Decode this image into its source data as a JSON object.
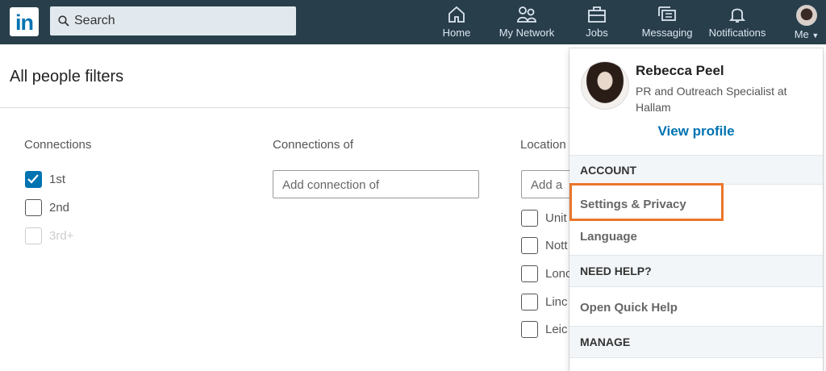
{
  "header": {
    "logo": "in",
    "search_placeholder": "Search",
    "nav": [
      {
        "label": "Home",
        "icon": "home-icon"
      },
      {
        "label": "My Network",
        "icon": "network-icon"
      },
      {
        "label": "Jobs",
        "icon": "briefcase-icon"
      },
      {
        "label": "Messaging",
        "icon": "messaging-icon"
      },
      {
        "label": "Notifications",
        "icon": "bell-icon"
      },
      {
        "label": "Me",
        "icon": "avatar"
      }
    ]
  },
  "page": {
    "title": "All people filters",
    "connections": {
      "label": "Connections",
      "options": [
        {
          "label": "1st",
          "checked": true
        },
        {
          "label": "2nd",
          "checked": false
        },
        {
          "label": "3rd+",
          "disabled": true
        }
      ]
    },
    "connections_of": {
      "label": "Connections of",
      "placeholder": "Add connection of"
    },
    "locations": {
      "label": "Location",
      "placeholder": "Add a",
      "options": [
        "Unit",
        "Nott",
        "Lonc",
        "Linc",
        "Leic"
      ]
    }
  },
  "menu": {
    "name": "Rebecca Peel",
    "headline": "PR and Outreach Specialist at Hallam",
    "view_profile": "View profile",
    "account": "ACCOUNT",
    "settings": "Settings & Privacy",
    "language": "Language",
    "help": "NEED HELP?",
    "quick_help": "Open Quick Help",
    "manage": "MANAGE",
    "highlight_color": "#e9762b"
  }
}
